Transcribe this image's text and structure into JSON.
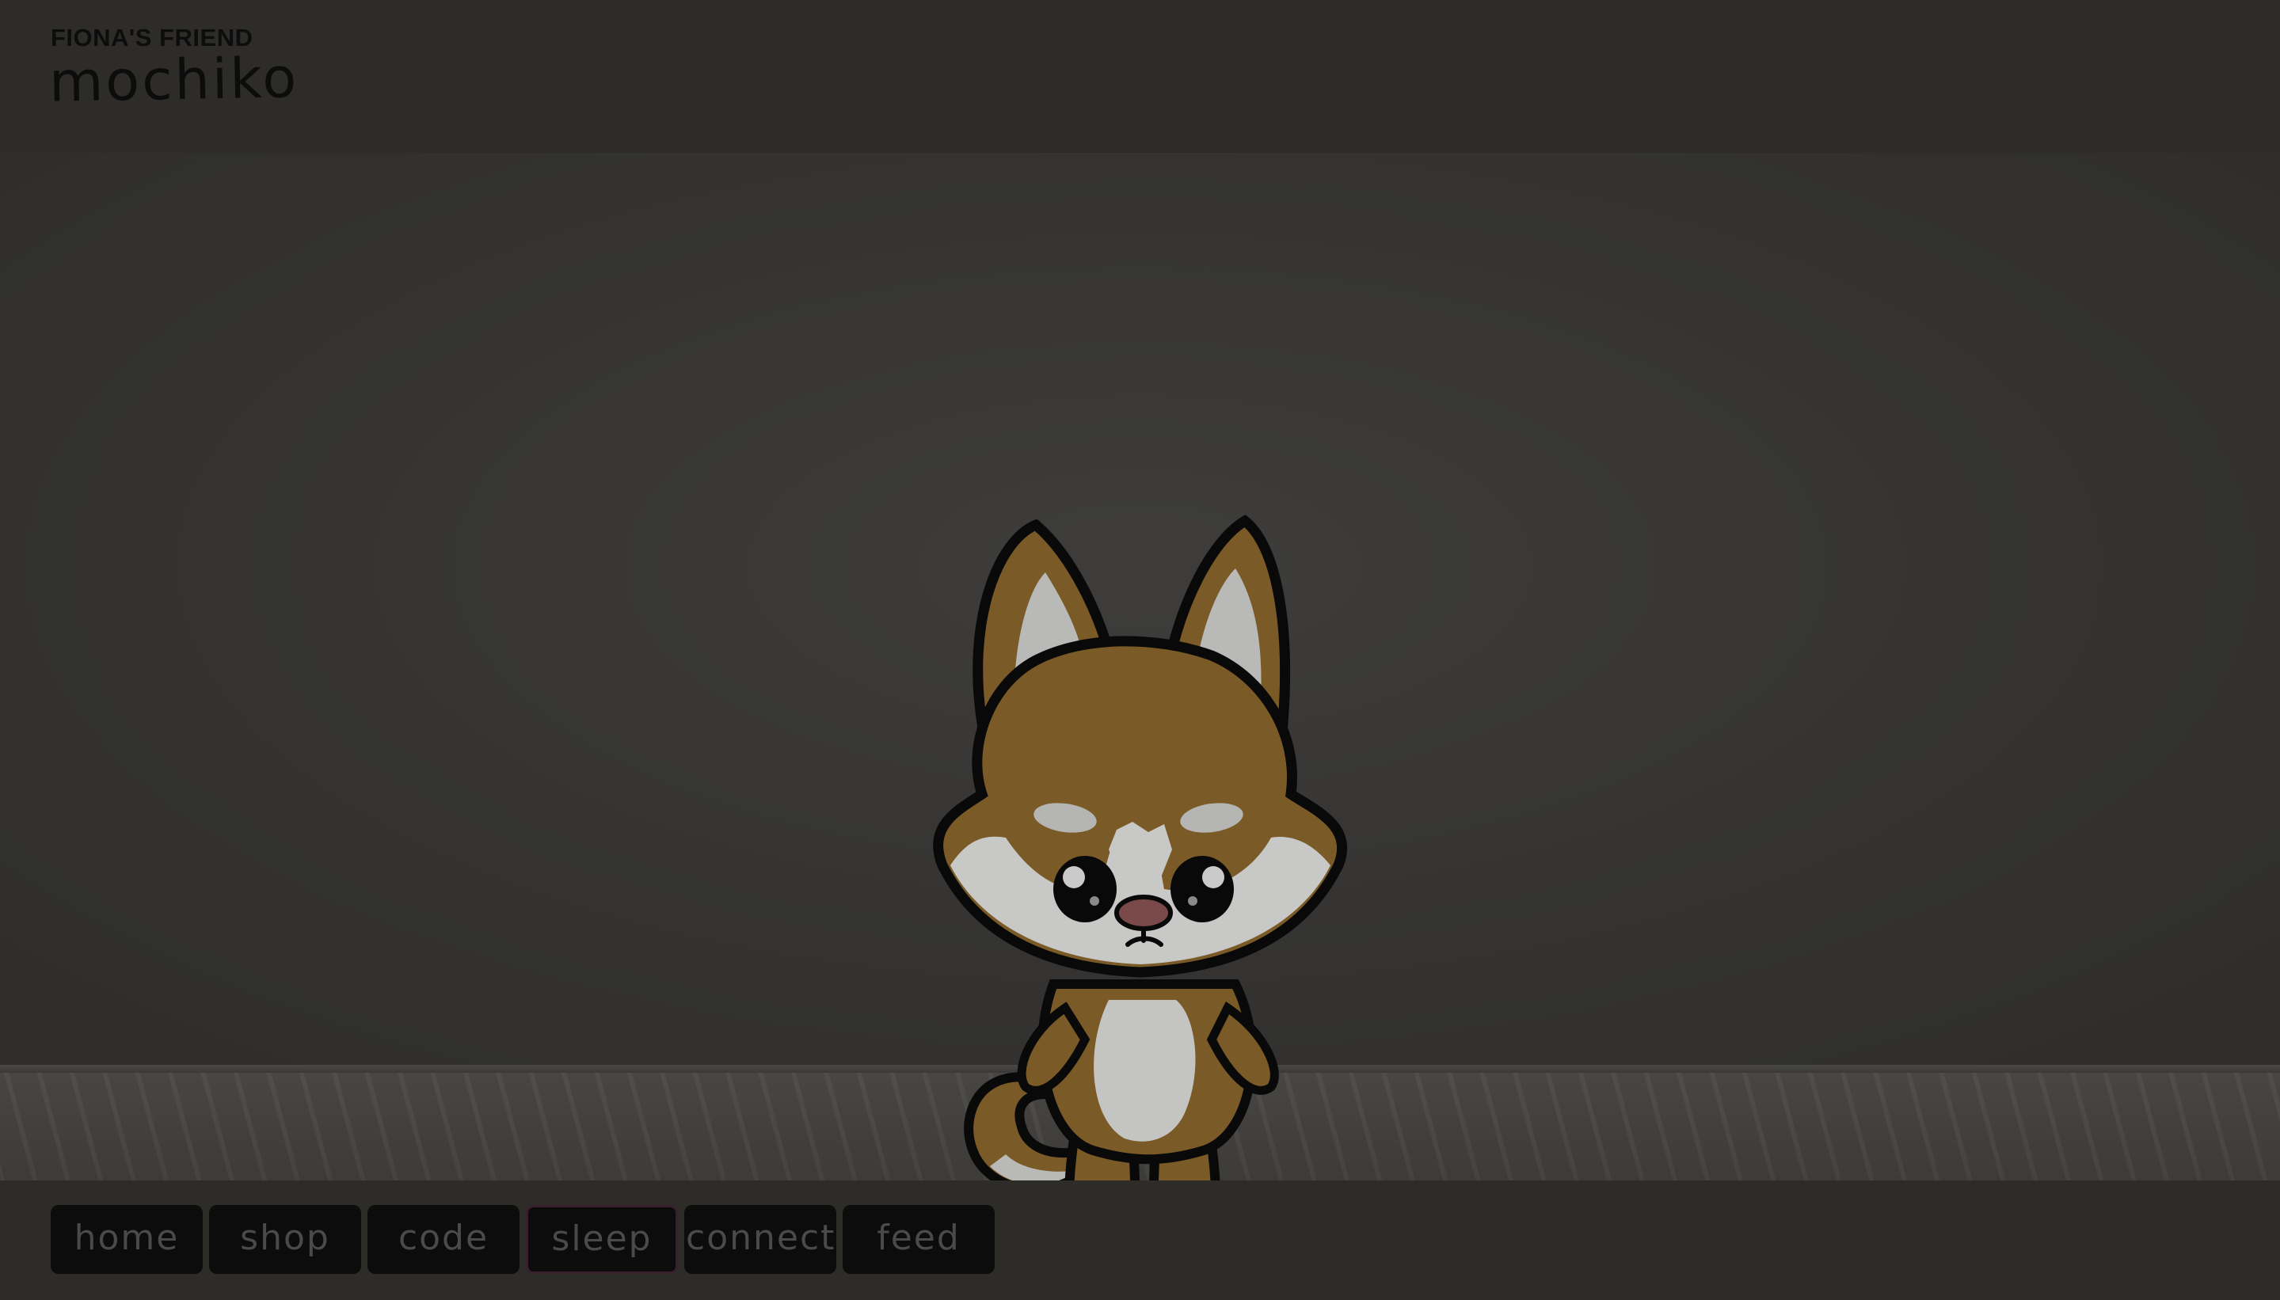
{
  "header": {
    "owner_label": "FIONA'S FRIEND",
    "pet_name": "mochiko"
  },
  "scene": {
    "character": "fox-pet"
  },
  "nav": {
    "items": [
      {
        "label": "home"
      },
      {
        "label": "shop"
      },
      {
        "label": "code"
      },
      {
        "label": "sleep",
        "active": true
      },
      {
        "label": "connect"
      },
      {
        "label": "feed"
      }
    ]
  },
  "colors": {
    "overlay_dim": "#2e2c29",
    "button_bg": "#0b0c0b",
    "button_text": "#4a4a48",
    "active_border": "#3a1f2f",
    "fox_orange": "#7a5a26"
  }
}
